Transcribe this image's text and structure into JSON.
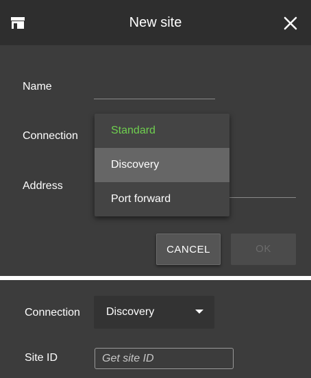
{
  "dialog": {
    "title": "New site",
    "name_label": "Name",
    "connection_label": "Connection",
    "address_label": "Address",
    "connection_options": [
      {
        "label": "Standard",
        "state": "selected"
      },
      {
        "label": "Discovery",
        "state": "hovered"
      },
      {
        "label": "Port forward",
        "state": "normal"
      }
    ],
    "cancel_label": "CANCEL",
    "ok_label": "OK"
  },
  "detail": {
    "connection_label": "Connection",
    "connection_value": "Discovery",
    "site_id_label": "Site ID",
    "site_id_placeholder": "Get site ID"
  },
  "colors": {
    "selected_option": "#6fcf4f",
    "panel_bg": "#3c3c3c",
    "titlebar_bg": "#2e2e2e"
  },
  "icons": {
    "title_left": "store-icon",
    "title_right": "close-icon",
    "dropdown": "caret-down-icon"
  }
}
